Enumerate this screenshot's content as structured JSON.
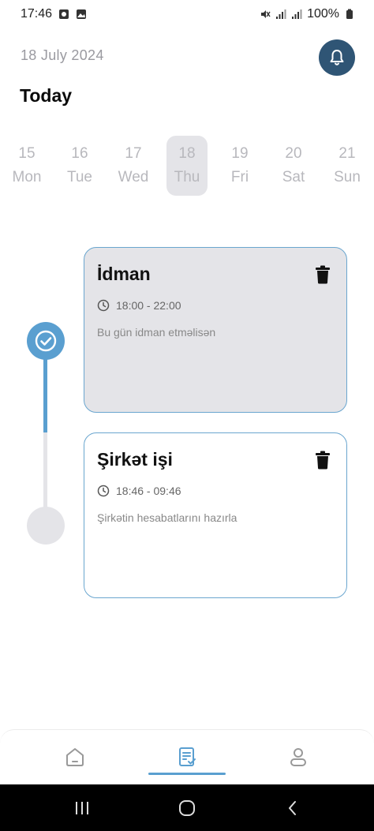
{
  "status_bar": {
    "time": "17:46",
    "battery": "100%"
  },
  "header": {
    "date": "18 July 2024",
    "title": "Today"
  },
  "week": [
    {
      "num": "15",
      "name": "Mon",
      "selected": false
    },
    {
      "num": "16",
      "name": "Tue",
      "selected": false
    },
    {
      "num": "17",
      "name": "Wed",
      "selected": false
    },
    {
      "num": "18",
      "name": "Thu",
      "selected": true
    },
    {
      "num": "19",
      "name": "Fri",
      "selected": false
    },
    {
      "num": "20",
      "name": "Sat",
      "selected": false
    },
    {
      "num": "21",
      "name": "Sun",
      "selected": false
    }
  ],
  "tasks": [
    {
      "title": "İdman",
      "time": "18:00 - 22:00",
      "description": "Bu gün idman etməlisən",
      "completed": true
    },
    {
      "title": "Şirkət işi",
      "time": "18:46 - 09:46",
      "description": "Şirkətin hesabatlarını hazırla",
      "completed": false
    }
  ],
  "colors": {
    "accent": "#5a9fd0",
    "bell_bg": "#2f5575",
    "card_done_bg": "#e4e4e8",
    "card_border": "#6aa6cf"
  },
  "bottom_nav": {
    "items": [
      "home-icon",
      "task-list-icon",
      "profile-icon"
    ],
    "active": "task-list-icon"
  }
}
